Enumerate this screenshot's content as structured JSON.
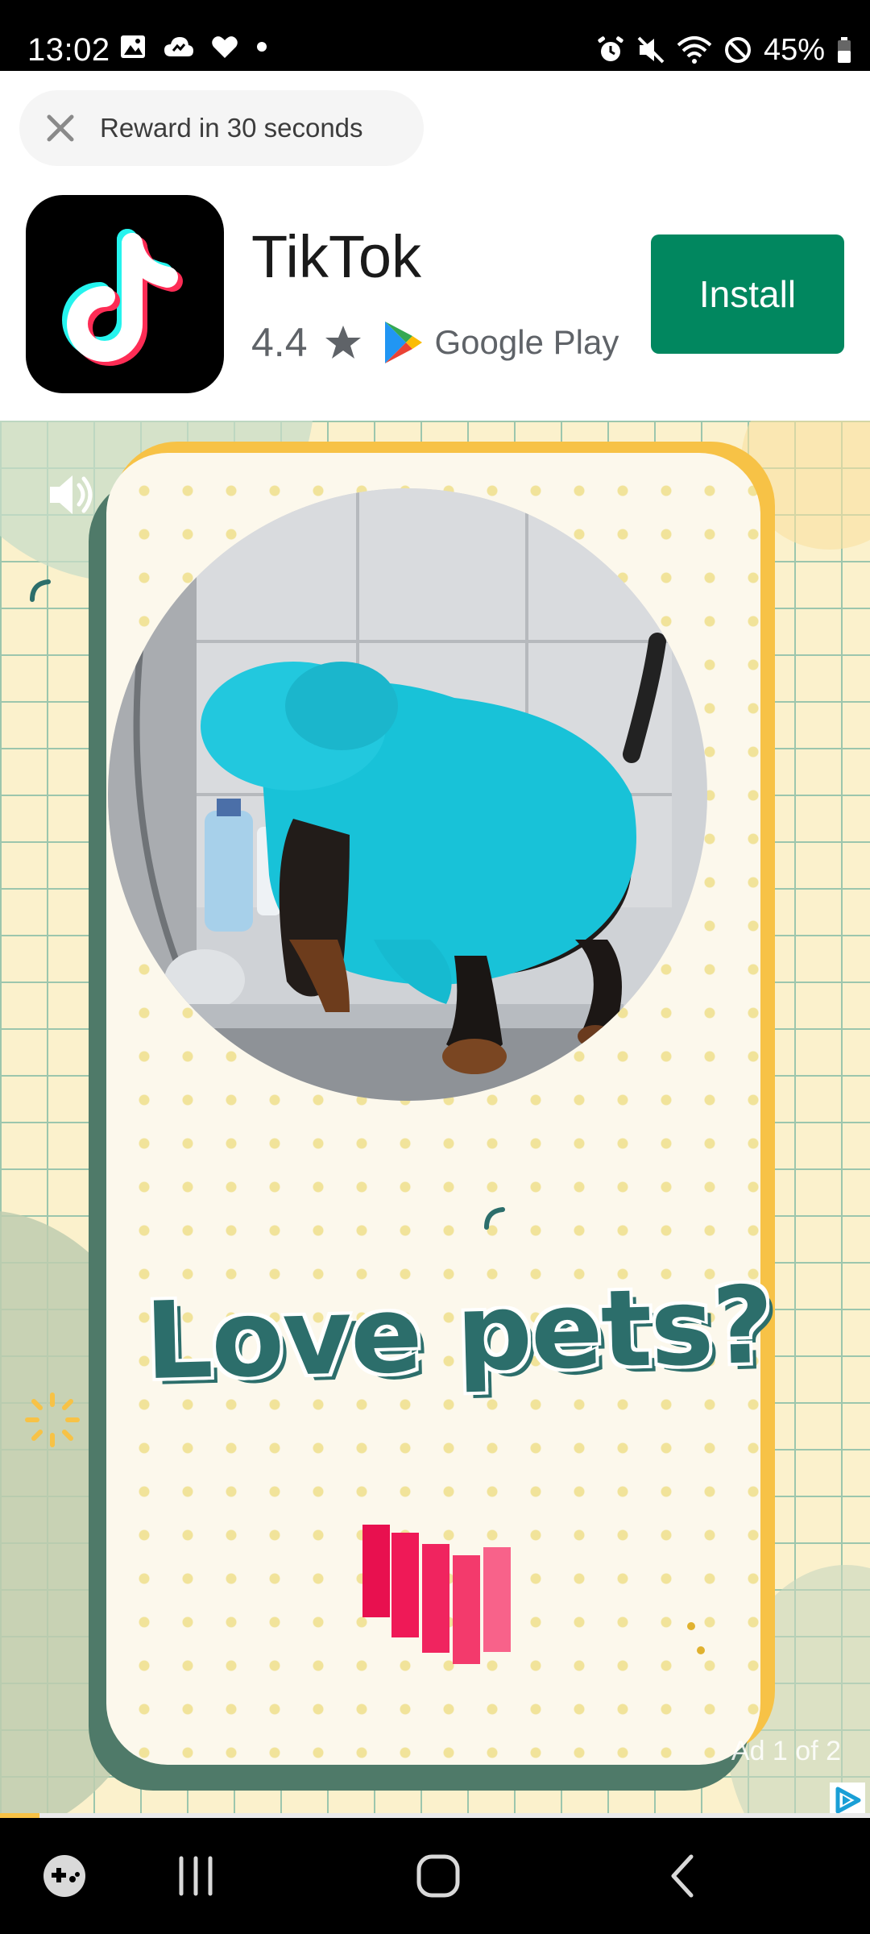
{
  "status_bar": {
    "time": "13:02",
    "battery": "45%",
    "left_icons": [
      "image-icon",
      "cloud-icon",
      "heart-icon",
      "dot-icon"
    ],
    "right_icons": [
      "alarm-icon",
      "mute-icon",
      "wifi-icon",
      "do-not-disturb-icon",
      "battery-icon"
    ]
  },
  "reward": {
    "text": "Reward in 30 seconds",
    "close_icon": "close-icon"
  },
  "app": {
    "name": "TikTok",
    "rating": "4.4",
    "store_name": "Google Play",
    "install_label": "Install",
    "accent_color": "#01875f"
  },
  "creative": {
    "headline": "Love pets?",
    "ad_counter": "Ad 1 of 2",
    "progress_fraction": 0.045,
    "colors": {
      "teal": "#2c6e6b",
      "yellow": "#f7c246",
      "green": "#4f7a69",
      "pink": "#f0245f"
    }
  },
  "nav_bar": {
    "items": [
      "game-launcher-icon",
      "recent-apps-icon",
      "home-icon",
      "back-icon"
    ]
  }
}
